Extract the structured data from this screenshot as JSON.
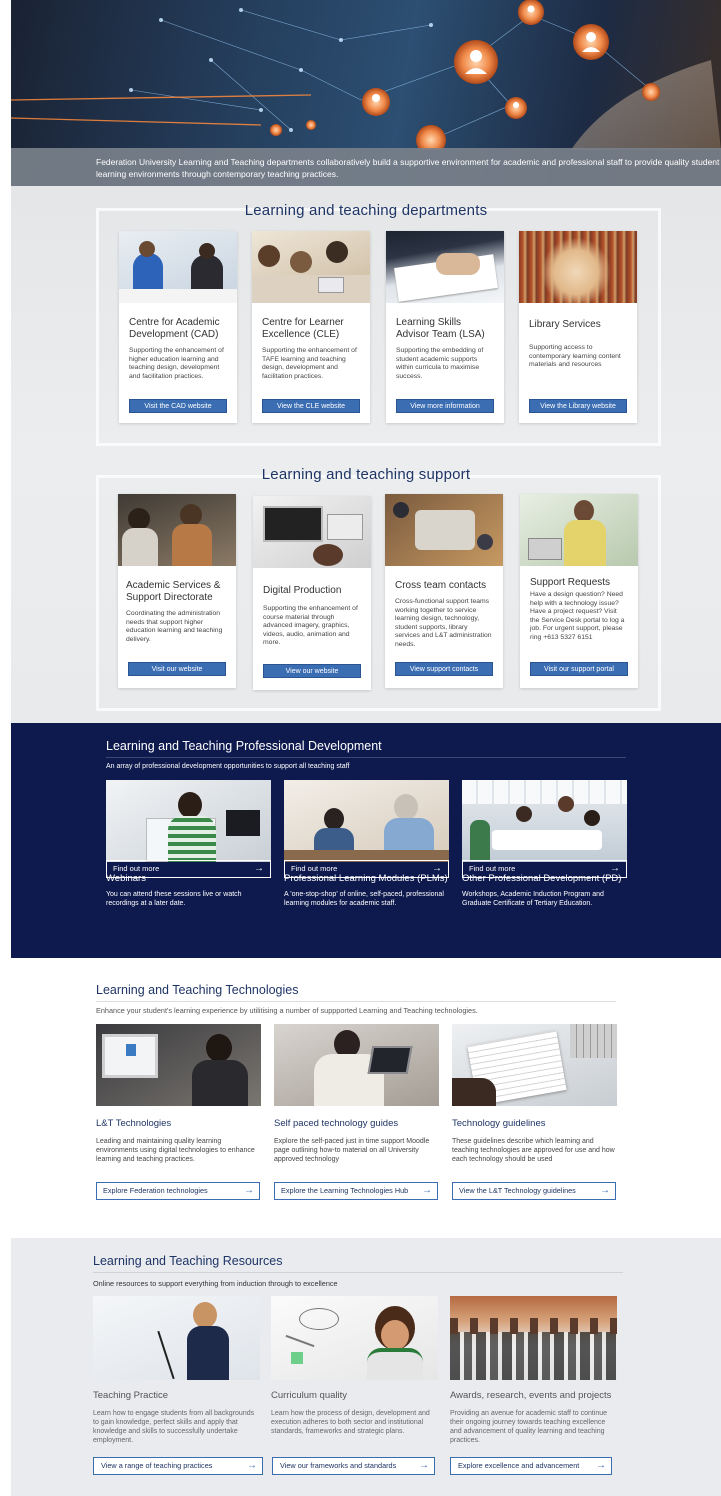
{
  "hero": {
    "caption": "Federation University Learning and Teaching departments collaboratively build a supportive environment for academic and professional staff to provide quality student learning environments through contemporary teaching practices."
  },
  "departments": {
    "title": "Learning and teaching departments",
    "cards": [
      {
        "title": "Centre for Academic Development (CAD)",
        "text": "Supporting the enhancement of higher education learning and teaching design, development and facilitation practices.",
        "button": "Visit the CAD website"
      },
      {
        "title": "Centre for Learner Excellence (CLE)",
        "text": "Supporting the enhancement of TAFE learning and teaching design, development and facilitation practices.",
        "button": "View the CLE website"
      },
      {
        "title": "Learning Skills Advisor Team (LSA)",
        "text": "Supporting the embedding of student academic supports within curricula to maximise success.",
        "button": "View more information"
      },
      {
        "title": "Library Services",
        "text": "Supporting access to contemporary learning content materials and resources",
        "button": "View the Library website"
      }
    ]
  },
  "support": {
    "title": "Learning and teaching support",
    "cards": [
      {
        "title": "Academic Services & Support Directorate",
        "text": "Coordinating the administration needs that support higher education learning and teaching delivery.",
        "button": "Visit our website"
      },
      {
        "title": "Digital Production",
        "text": "Supporting the enhancement of course material through advanced imagery, graphics, videos, audio, animation and more.",
        "button": "View our website"
      },
      {
        "title": "Cross team contacts",
        "text": "Cross-functional support teams working together to service learning design, technology, student supports, library services and L&T administration needs.",
        "button": "View support contacts"
      },
      {
        "title": "Support Requests",
        "text": "Have a design question? Need help with a technology issue? Have a project request? Visit the Service Desk portal to log a job. For urgent support, please ring +613 5327 6151",
        "button": "Visit our support portal"
      }
    ]
  },
  "pd": {
    "title": "Learning and Teaching Professional Development",
    "subtitle": "An array of professional development opportunities to support all teaching staff",
    "cards": [
      {
        "title": "Webinars",
        "text": "You can attend these sessions live or watch recordings at a later date.",
        "button": "Find out more"
      },
      {
        "title": "Professional Learning Modules (PLMs)",
        "text": "A 'one-stop-shop' of online, self-paced, professional learning modules for academic staff.",
        "button": "Find out more"
      },
      {
        "title": "Other Professional Development (PD)",
        "text": "Workshops, Academic Induction Program and Graduate Certificate of Tertiary Education.",
        "button": "Find out more"
      }
    ]
  },
  "tech": {
    "title": "Learning and Teaching Technologies",
    "subtitle": "Enhance your student's learning experience by utilitising a number of suppported Learning and Teaching technologies.",
    "cards": [
      {
        "title": "L&T Technologies",
        "text": "Leading and maintaining quality learning environments using digital technologies to enhance learning and teaching practices.",
        "button": "Explore Federation technologies"
      },
      {
        "title": "Self paced technology guides",
        "text": "Explore the self-paced just in time support Moodle page outlining how-to material on all University approved technology",
        "button": "Explore the Learning Technologies Hub"
      },
      {
        "title": "Technology guidelines",
        "text": "These guidelines describe which learning and teaching technologies are approved for use and how each technology should be used",
        "button": "View the L&T Technology guidelines"
      }
    ]
  },
  "resources": {
    "title": "Learning and Teaching Resources",
    "subtitle": "Online resources to support everything from induction through to excellence",
    "cards": [
      {
        "title": "Teaching Practice",
        "text": "Learn how to engage students from all backgrounds to gain knowledge, perfect skills and apply that knowledge and skills to successfully undertake employment.",
        "button": "View a range of teaching practices"
      },
      {
        "title": "Curriculum quality",
        "text": "Learn how the process of design, development and execution adheres to both sector and institutional standards, frameworks and strategic plans.",
        "button": "View our frameworks and standards"
      },
      {
        "title": "Awards, research, events and projects",
        "text": "Providing an avenue for academic staff to continue their ongoing journey towards teaching excellence and advancement of quality learning and teaching practices.",
        "button": "Explore excellence and advancement"
      }
    ]
  },
  "icons": {
    "arrow": "→"
  },
  "colors": {
    "navy": "#0e1a4e",
    "title_blue": "#1f3566",
    "button_blue": "#3b6db3",
    "grey_band": "#e4e6e8"
  }
}
